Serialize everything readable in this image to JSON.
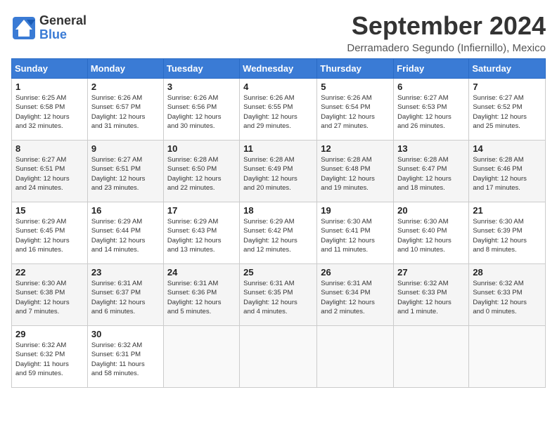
{
  "header": {
    "logo_general": "General",
    "logo_blue": "Blue",
    "title": "September 2024",
    "subtitle": "Derramadero Segundo (Infiernillo), Mexico"
  },
  "weekdays": [
    "Sunday",
    "Monday",
    "Tuesday",
    "Wednesday",
    "Thursday",
    "Friday",
    "Saturday"
  ],
  "weeks": [
    [
      {
        "day": "1",
        "info": "Sunrise: 6:25 AM\nSunset: 6:58 PM\nDaylight: 12 hours\nand 32 minutes."
      },
      {
        "day": "2",
        "info": "Sunrise: 6:26 AM\nSunset: 6:57 PM\nDaylight: 12 hours\nand 31 minutes."
      },
      {
        "day": "3",
        "info": "Sunrise: 6:26 AM\nSunset: 6:56 PM\nDaylight: 12 hours\nand 30 minutes."
      },
      {
        "day": "4",
        "info": "Sunrise: 6:26 AM\nSunset: 6:55 PM\nDaylight: 12 hours\nand 29 minutes."
      },
      {
        "day": "5",
        "info": "Sunrise: 6:26 AM\nSunset: 6:54 PM\nDaylight: 12 hours\nand 27 minutes."
      },
      {
        "day": "6",
        "info": "Sunrise: 6:27 AM\nSunset: 6:53 PM\nDaylight: 12 hours\nand 26 minutes."
      },
      {
        "day": "7",
        "info": "Sunrise: 6:27 AM\nSunset: 6:52 PM\nDaylight: 12 hours\nand 25 minutes."
      }
    ],
    [
      {
        "day": "8",
        "info": "Sunrise: 6:27 AM\nSunset: 6:51 PM\nDaylight: 12 hours\nand 24 minutes."
      },
      {
        "day": "9",
        "info": "Sunrise: 6:27 AM\nSunset: 6:51 PM\nDaylight: 12 hours\nand 23 minutes."
      },
      {
        "day": "10",
        "info": "Sunrise: 6:28 AM\nSunset: 6:50 PM\nDaylight: 12 hours\nand 22 minutes."
      },
      {
        "day": "11",
        "info": "Sunrise: 6:28 AM\nSunset: 6:49 PM\nDaylight: 12 hours\nand 20 minutes."
      },
      {
        "day": "12",
        "info": "Sunrise: 6:28 AM\nSunset: 6:48 PM\nDaylight: 12 hours\nand 19 minutes."
      },
      {
        "day": "13",
        "info": "Sunrise: 6:28 AM\nSunset: 6:47 PM\nDaylight: 12 hours\nand 18 minutes."
      },
      {
        "day": "14",
        "info": "Sunrise: 6:28 AM\nSunset: 6:46 PM\nDaylight: 12 hours\nand 17 minutes."
      }
    ],
    [
      {
        "day": "15",
        "info": "Sunrise: 6:29 AM\nSunset: 6:45 PM\nDaylight: 12 hours\nand 16 minutes."
      },
      {
        "day": "16",
        "info": "Sunrise: 6:29 AM\nSunset: 6:44 PM\nDaylight: 12 hours\nand 14 minutes."
      },
      {
        "day": "17",
        "info": "Sunrise: 6:29 AM\nSunset: 6:43 PM\nDaylight: 12 hours\nand 13 minutes."
      },
      {
        "day": "18",
        "info": "Sunrise: 6:29 AM\nSunset: 6:42 PM\nDaylight: 12 hours\nand 12 minutes."
      },
      {
        "day": "19",
        "info": "Sunrise: 6:30 AM\nSunset: 6:41 PM\nDaylight: 12 hours\nand 11 minutes."
      },
      {
        "day": "20",
        "info": "Sunrise: 6:30 AM\nSunset: 6:40 PM\nDaylight: 12 hours\nand 10 minutes."
      },
      {
        "day": "21",
        "info": "Sunrise: 6:30 AM\nSunset: 6:39 PM\nDaylight: 12 hours\nand 8 minutes."
      }
    ],
    [
      {
        "day": "22",
        "info": "Sunrise: 6:30 AM\nSunset: 6:38 PM\nDaylight: 12 hours\nand 7 minutes."
      },
      {
        "day": "23",
        "info": "Sunrise: 6:31 AM\nSunset: 6:37 PM\nDaylight: 12 hours\nand 6 minutes."
      },
      {
        "day": "24",
        "info": "Sunrise: 6:31 AM\nSunset: 6:36 PM\nDaylight: 12 hours\nand 5 minutes."
      },
      {
        "day": "25",
        "info": "Sunrise: 6:31 AM\nSunset: 6:35 PM\nDaylight: 12 hours\nand 4 minutes."
      },
      {
        "day": "26",
        "info": "Sunrise: 6:31 AM\nSunset: 6:34 PM\nDaylight: 12 hours\nand 2 minutes."
      },
      {
        "day": "27",
        "info": "Sunrise: 6:32 AM\nSunset: 6:33 PM\nDaylight: 12 hours\nand 1 minute."
      },
      {
        "day": "28",
        "info": "Sunrise: 6:32 AM\nSunset: 6:33 PM\nDaylight: 12 hours\nand 0 minutes."
      }
    ],
    [
      {
        "day": "29",
        "info": "Sunrise: 6:32 AM\nSunset: 6:32 PM\nDaylight: 11 hours\nand 59 minutes."
      },
      {
        "day": "30",
        "info": "Sunrise: 6:32 AM\nSunset: 6:31 PM\nDaylight: 11 hours\nand 58 minutes."
      },
      {
        "day": "",
        "info": ""
      },
      {
        "day": "",
        "info": ""
      },
      {
        "day": "",
        "info": ""
      },
      {
        "day": "",
        "info": ""
      },
      {
        "day": "",
        "info": ""
      }
    ]
  ]
}
